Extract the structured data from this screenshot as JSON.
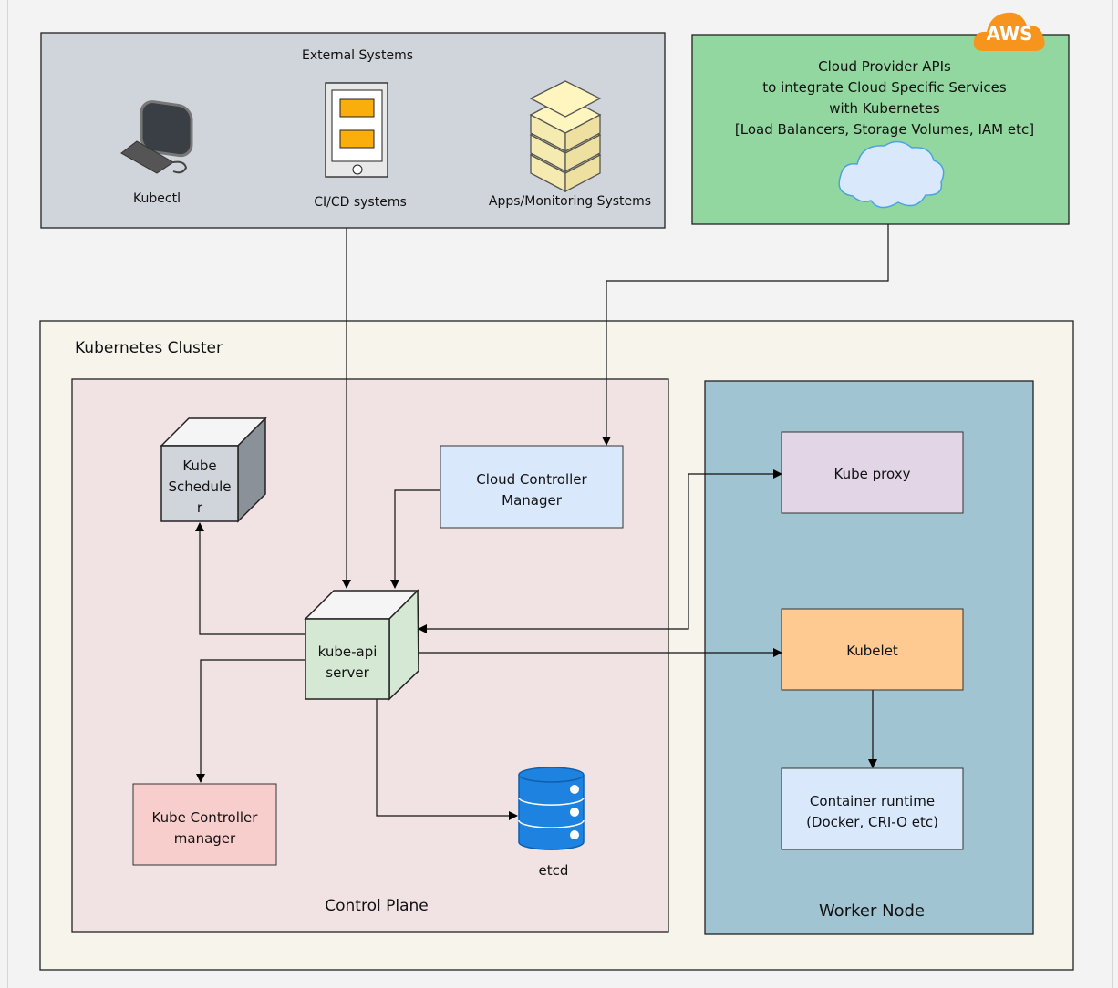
{
  "external": {
    "title": "External Systems",
    "kubectl": "Kubectl",
    "cicd": "CI/CD systems",
    "apps": "Apps/Monitoring Systems"
  },
  "cloud_provider": {
    "badge": "AWS",
    "text": "Cloud Provider APIs\nto integrate Cloud Specific Services\nwith Kubernetes\n[Load Balancers, Storage Volumes, IAM etc]"
  },
  "cluster": {
    "title": "Kubernetes Cluster"
  },
  "control_plane": {
    "title": "Control Plane",
    "scheduler": "Kube\nSchedule\nr",
    "api_server": "kube-api\nserver",
    "ccm": "Cloud Controller\nManager",
    "kcm": "Kube Controller\nmanager",
    "etcd": "etcd"
  },
  "worker": {
    "title": "Worker Node",
    "proxy": "Kube proxy",
    "kubelet": "Kubelet",
    "runtime": "Container runtime\n(Docker, CRI-O etc)"
  },
  "colors": {
    "external": "#d0d5dc",
    "cloud": "#93d7a0",
    "cluster": "#f7f4ec",
    "control_plane": "#f1e3e3",
    "worker": "#a0c4d2",
    "proxy": "#e1d5e6",
    "kubelet": "#ffc992",
    "runtime": "#dae8fc",
    "kcm": "#f8cecc",
    "api": "#d5e8d4",
    "etcd": "#1e82e0",
    "aws": "#f7941d"
  }
}
